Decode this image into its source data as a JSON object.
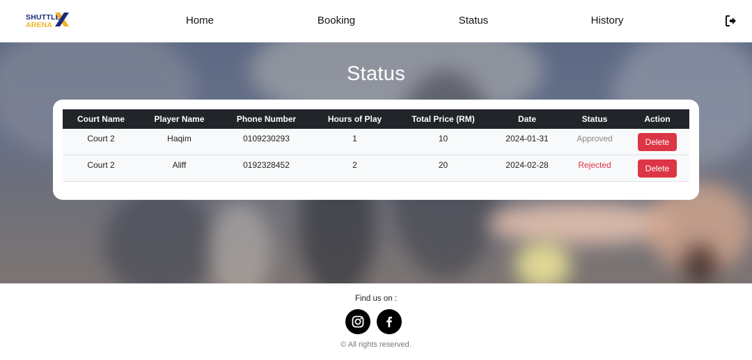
{
  "brand": {
    "line1": "SHUTTLE",
    "line2": "ARENA",
    "navy": "#1b2a7a",
    "gold": "#f0b323"
  },
  "nav": {
    "items": [
      {
        "label": "Home"
      },
      {
        "label": "Booking"
      },
      {
        "label": "Status"
      },
      {
        "label": "History"
      }
    ],
    "logout_icon": "logout-icon"
  },
  "page": {
    "title": "Status"
  },
  "table": {
    "headers": [
      "Court Name",
      "Player Name",
      "Phone Number",
      "Hours of Play",
      "Total Price (RM)",
      "Date",
      "Status",
      "Action"
    ],
    "rows": [
      {
        "court": "Court 2",
        "player": "Haqim",
        "phone": "0109230293",
        "hours": "1",
        "price": "10",
        "date": "2024-01-31",
        "status": "Approved",
        "status_color": "#888888",
        "action": "Delete"
      },
      {
        "court": "Court 2",
        "player": "Aliff",
        "phone": "0192328452",
        "hours": "2",
        "price": "20",
        "date": "2024-02-28",
        "status": "Rejected",
        "status_color": "#dc3545",
        "action": "Delete"
      }
    ]
  },
  "footer": {
    "find_us": "Find us on :",
    "social": [
      "instagram-icon",
      "facebook-icon"
    ],
    "rights": "© All rights reserved."
  },
  "colors": {
    "delete_button": "#dc3545",
    "table_header": "#212529"
  }
}
